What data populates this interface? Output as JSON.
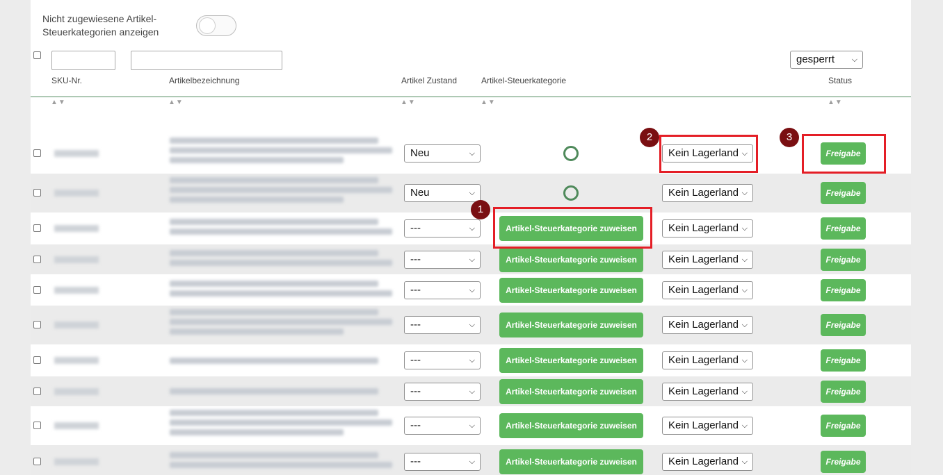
{
  "filter": {
    "unassigned_toggle_label": "Nicht zugewiesene Artikel-Steuerkategorien anzeigen",
    "toggle_on": false,
    "status_filter_value": "gesperrt"
  },
  "columns": {
    "sku": "SKU-Nr.",
    "name": "Artikelbezeichnung",
    "condition": "Artikel Zustand",
    "tax_category": "Artikel-Steuerkategorie",
    "status": "Status"
  },
  "rows": [
    {
      "condition": "Neu",
      "tax": "ring",
      "warehouse": "Kein Lagerland",
      "status": "Freigabe"
    },
    {
      "condition": "Neu",
      "tax": "ring",
      "warehouse": "Kein Lagerland",
      "status": "Freigabe"
    },
    {
      "condition": "---",
      "tax": "Artikel-Steuerkategorie zuweisen",
      "warehouse": "Kein Lagerland",
      "status": "Freigabe"
    },
    {
      "condition": "---",
      "tax": "Artikel-Steuerkategorie zuweisen",
      "warehouse": "Kein Lagerland",
      "status": "Freigabe"
    },
    {
      "condition": "---",
      "tax": "Artikel-Steuerkategorie zuweisen",
      "warehouse": "Kein Lagerland",
      "status": "Freigabe"
    },
    {
      "condition": "---",
      "tax": "Artikel-Steuerkategorie zuweisen",
      "warehouse": "Kein Lagerland",
      "status": "Freigabe"
    },
    {
      "condition": "---",
      "tax": "Artikel-Steuerkategorie zuweisen",
      "warehouse": "Kein Lagerland",
      "status": "Freigabe"
    },
    {
      "condition": "---",
      "tax": "Artikel-Steuerkategorie zuweisen",
      "warehouse": "Kein Lagerland",
      "status": "Freigabe"
    },
    {
      "condition": "---",
      "tax": "Artikel-Steuerkategorie zuweisen",
      "warehouse": "Kein Lagerland",
      "status": "Freigabe"
    },
    {
      "condition": "---",
      "tax": "Artikel-Steuerkategorie zuweisen",
      "warehouse": "Kein Lagerland",
      "status": "Freigabe"
    }
  ],
  "annotations": [
    "1",
    "2",
    "3"
  ],
  "colors": {
    "button_green": "#5cb85c",
    "header_line": "#4f8a5b",
    "highlight_red": "#e41e26",
    "badge": "#7a0f12"
  },
  "icons": {
    "sort": "sort-up-down-icon",
    "dropdown": "chevron-down-icon",
    "tax_assigned": "circle-outline-icon"
  }
}
